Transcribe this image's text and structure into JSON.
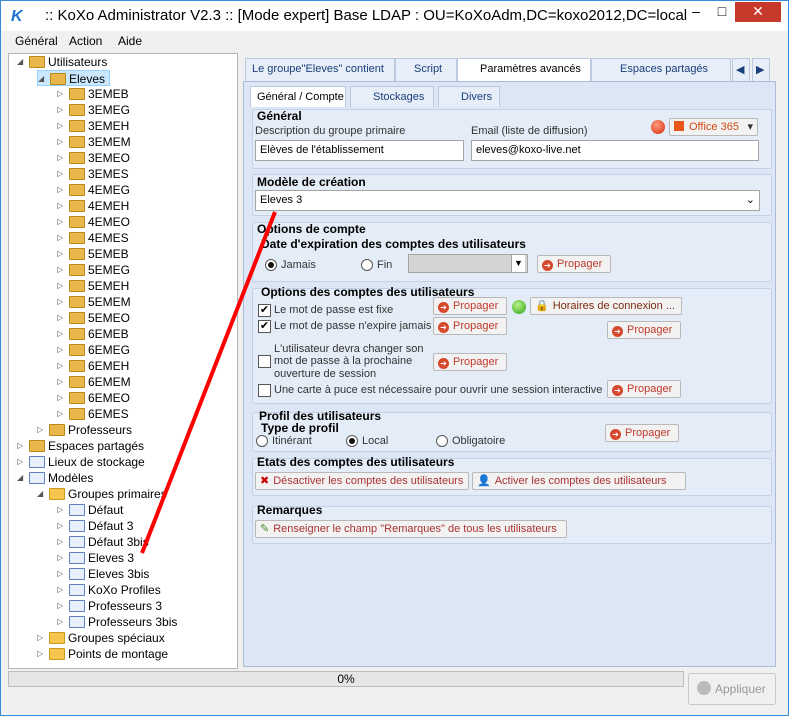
{
  "window": {
    "title": ":: KoXo Administrator V2.3 :: [Mode expert] Base LDAP : OU=KoXoAdm,DC=koxo2012,DC=local",
    "app_icon": "K",
    "minimize_glyph": "–",
    "maximize_glyph": "□",
    "close_glyph": "✕"
  },
  "menu": {
    "items": [
      "Général",
      "Action",
      "Aide"
    ]
  },
  "tree": {
    "utilisateurs": "Utilisateurs",
    "eleves": "Eleves",
    "classes": [
      "3EMEB",
      "3EMEG",
      "3EMEH",
      "3EMEM",
      "3EMEO",
      "3EMES",
      "4EMEG",
      "4EMEH",
      "4EMEO",
      "4EMES",
      "5EMEB",
      "5EMEG",
      "5EMEH",
      "5EMEM",
      "5EMEO",
      "6EMEB",
      "6EMEG",
      "6EMEH",
      "6EMEM",
      "6EMEO",
      "6EMES"
    ],
    "professeurs": "Professeurs",
    "espaces_partages": "Espaces partagés",
    "lieux_stockage": "Lieux de stockage",
    "modeles": "Modèles",
    "groupes_primaires": "Groupes primaires",
    "modeles_items": [
      "Défaut",
      "Défaut 3",
      "Défaut 3bis",
      "Eleves 3",
      "Eleves 3bis",
      "KoXo Profiles",
      "Professeurs 3",
      "Professeurs 3bis"
    ],
    "groupes_speciaux": "Groupes spéciaux",
    "points_montage": "Points de montage"
  },
  "tabs": {
    "main": [
      "Le groupe\"Eleves\" contient",
      "Script",
      "Paramètres avancés",
      "Espaces partagés"
    ],
    "sub": [
      "Général / Compte",
      "Stockages",
      "Divers"
    ],
    "nav_prev": "◀",
    "nav_next": "▶"
  },
  "general": {
    "title": "Général",
    "desc_label": "Description du groupe primaire",
    "desc_value": "Elèves de l'établissement",
    "email_label": "Email (liste de diffusion)",
    "email_value": "eleves@koxo-live.net",
    "office_btn": "Office 365"
  },
  "modele": {
    "title": "Modèle de création",
    "value": "Eleves 3"
  },
  "options": {
    "title": "Options de compte",
    "expiration_title": "Date d'expiration des comptes des utilisateurs",
    "jamais": "Jamais",
    "fin": "Fin",
    "propager": "Propager"
  },
  "options_comptes": {
    "title": "Options des comptes des utilisateurs",
    "pwd_fixe": "Le mot de passe est fixe",
    "pwd_noexpire": "Le mot de passe n'expire jamais",
    "change_pwd_1": "L'utilisateur devra changer son",
    "change_pwd_2": "mot de passe à la prochaine",
    "change_pwd_3": "ouverture de session",
    "smartcard": "Une carte à puce est nécessaire pour ouvrir une session interactive",
    "horaires": "Horaires de connexion ..."
  },
  "profil": {
    "title": "Profil des utilisateurs",
    "type_title": "Type de profil",
    "itinerant": "Itinérant",
    "local": "Local",
    "obligatoire": "Obligatoire"
  },
  "etats": {
    "title": "Etats des comptes des utilisateurs",
    "desactiver": "Désactiver les comptes des utilisateurs",
    "activer": "Activer les comptes des utilisateurs"
  },
  "remarques": {
    "title": "Remarques",
    "btn": "Renseigner le champ \"Remarques\" de tous les utilisateurs"
  },
  "status": {
    "progress": "0%",
    "apply": "Appliquer"
  },
  "colors": {
    "accent": "#1e73d0",
    "propager_red": "#c0392b",
    "panel": "#dce6f4"
  }
}
